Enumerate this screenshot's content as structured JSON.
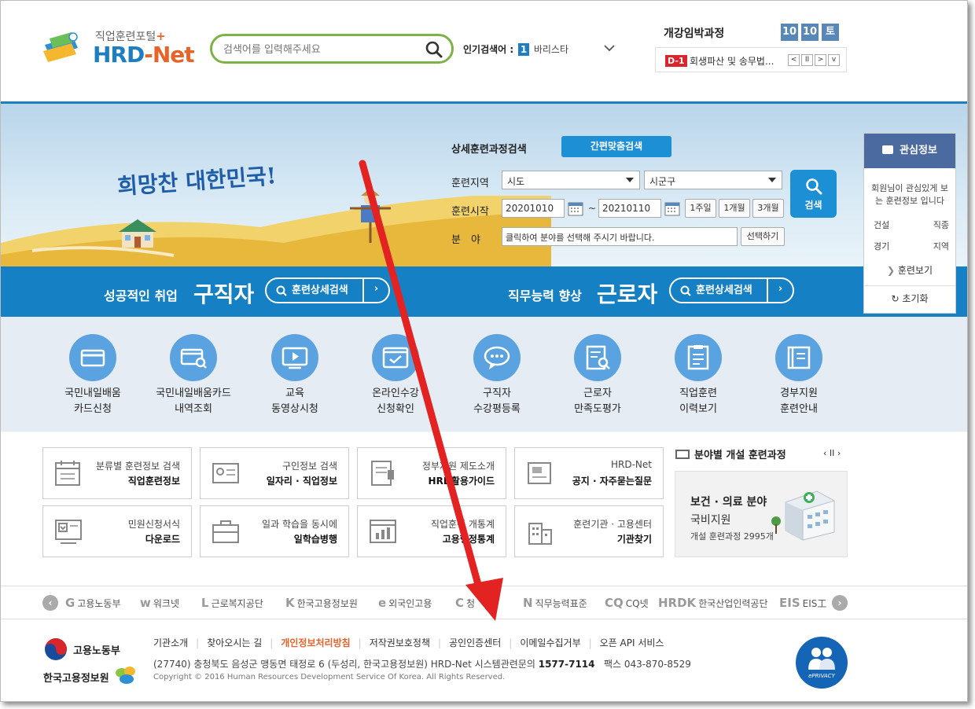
{
  "header": {
    "logo_sub": "직업훈련포털",
    "logo_plus": "+",
    "logo_main_a": "HRD",
    "logo_main_b": "-Net",
    "search_placeholder": "검색어를 입력해주세요",
    "popular_label": "인기검색어 :",
    "popular_rank": "1",
    "popular_term": "바리스타",
    "soon_title": "개강임박과정",
    "date_boxes": [
      "10",
      "10",
      "토"
    ],
    "ticker_badge": "D-1",
    "ticker_text": "회생파산 및 송무법...",
    "ticker_buttons": [
      "<",
      "II",
      ">",
      "v"
    ]
  },
  "hero": {
    "slogan": "희망찬 대한민국!",
    "form_title": "상세훈련과정검색",
    "quick_button": "간편맞춤검색",
    "region_label": "훈련지역",
    "region_sido": "시도",
    "region_sigungu": "시군구",
    "start_label": "훈련시작",
    "date_from": "20201010",
    "date_sep": "~",
    "date_to": "20210110",
    "period_buttons": [
      "1주일",
      "1개월",
      "3개월"
    ],
    "field_label": "분　야",
    "field_placeholder": "클릭하여 분야를 선택해 주시기 바랍니다.",
    "select_button": "선택하기",
    "search_button": "검색"
  },
  "band": {
    "left_small": "성공적인 취업",
    "left_big": "구직자",
    "left_btn": "훈련상세검색",
    "right_small": "직무능력 향상",
    "right_big": "근로자",
    "right_btn": "훈련상세검색"
  },
  "interest": {
    "title": "관심정보",
    "desc": "회원님이 관심있게 보는 훈련정보 입니다",
    "rows": [
      {
        "left": "건설",
        "right": "직종"
      },
      {
        "left": "경기",
        "right": "지역"
      }
    ],
    "view_link": "훈련보기",
    "reset_link": "초기화"
  },
  "icon_menu": [
    {
      "line1": "국민내일배움",
      "line2": "카드신청",
      "icon": "card-icon"
    },
    {
      "line1": "국민내일배움카드",
      "line2": "내역조회",
      "icon": "card-search-icon"
    },
    {
      "line1": "교육",
      "line2": "동영상시청",
      "icon": "video-icon"
    },
    {
      "line1": "온라인수강",
      "line2": "신청확인",
      "icon": "online-check-icon"
    },
    {
      "line1": "구직자",
      "line2": "수강평등록",
      "icon": "chat-icon"
    },
    {
      "line1": "근로자",
      "line2": "만족도평가",
      "icon": "evaluation-icon"
    },
    {
      "line1": "직업훈련",
      "line2": "이력보기",
      "icon": "history-icon"
    },
    {
      "line1": "경부지원",
      "line2": "훈련안내",
      "icon": "book-icon"
    }
  ],
  "boxes": [
    {
      "t1": "분류별 훈련정보 검색",
      "t2": "직업훈련정보",
      "icon": "calendar-icon"
    },
    {
      "t1": "구인정보 검색",
      "t2": "일자리 · 직업정보",
      "icon": "id-card-icon"
    },
    {
      "t1": "정부지원 제도소개",
      "t2": "HRD활용가이드",
      "icon": "guide-icon"
    },
    {
      "t1": "HRD-Net",
      "t2": "공지 · 자주묻는질문",
      "icon": "notice-icon"
    },
    {
      "t1": "민원신청서식",
      "t2": "다운로드",
      "icon": "download-icon"
    },
    {
      "t1": "일과 학습을 동시에",
      "t2": "일학습병행",
      "icon": "briefcase-icon"
    },
    {
      "t1": "직업훈련 개통계",
      "t2": "고용행정통계",
      "icon": "stats-icon"
    },
    {
      "t1": "훈련기관 · 고용센터",
      "t2": "기관찾기",
      "icon": "building-icon"
    }
  ],
  "field_panel": {
    "title": "분야별 개설 훈련과정",
    "controls": "‹ II ›",
    "name": "보건 · 의료 분야",
    "support": "국비지원",
    "count": "개설 훈련과정 2995개"
  },
  "partners": [
    {
      "logo": "G",
      "name": "고용노동부"
    },
    {
      "logo": "w",
      "name": "워크넷"
    },
    {
      "logo": "L",
      "name": "근로복지공단"
    },
    {
      "logo": "K",
      "name": "한국고용정보원"
    },
    {
      "logo": "e",
      "name": "외국인고용"
    },
    {
      "logo": "C",
      "name": "청"
    },
    {
      "logo": "N",
      "name": "직무능력표준"
    },
    {
      "logo": "CQ",
      "name": "CQ넷"
    },
    {
      "logo": "HRDK",
      "name": "한국산업인력공단"
    },
    {
      "logo": "EIS",
      "name": "EIS工"
    }
  ],
  "footer": {
    "org1": "고용노동부",
    "org2": "한국고용정보원",
    "links": [
      "기관소개",
      "찾아오시는 길",
      "개인정보처리방침",
      "저작권보호정책",
      "공인인증센터",
      "이메일수집거부",
      "오픈 API 서비스"
    ],
    "address": "(27740) 충청북도 음성군 맹동면 태정로 6 (두성리, 한국고용정보원) HRD-Net 시스템관련문의",
    "phone": "1577-7114",
    "fax": "팩스 043-870-8529",
    "copyright": "Copyright © 2016 Human Resources Development Service Of Korea. All Rights Reserved.",
    "eprivacy": "ePRIVACY"
  },
  "colors": {
    "brand_blue": "#1580c4",
    "brand_orange": "#e8632a",
    "search_green": "#7db246",
    "arrow_red": "#e32222"
  }
}
